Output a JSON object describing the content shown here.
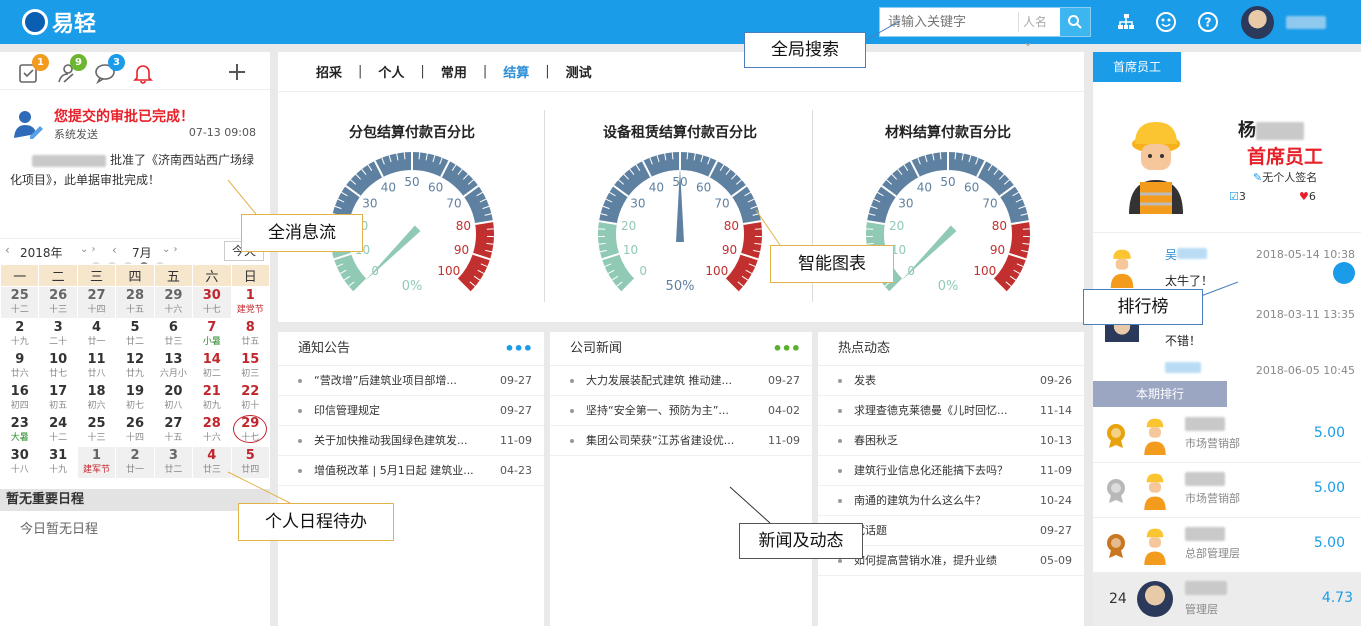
{
  "header": {
    "logo_text": "易轻",
    "search_placeholder": "请输入关键字",
    "search_scope": "人名",
    "icons": [
      "org-chart-icon",
      "smile-icon",
      "help-icon"
    ]
  },
  "left": {
    "badges": {
      "tasks": "1",
      "contacts": "9",
      "chat": "3"
    },
    "message": {
      "title": "您提交的审批已完成！",
      "from": "系统发送",
      "time": "07-13 09:08",
      "body": "批准了《济南西站西广场绿化项目》，此单据审批完成！"
    },
    "calendar": {
      "year": "2018年",
      "month": "7月",
      "today": "今天",
      "weekdays": [
        "一",
        "二",
        "三",
        "四",
        "五",
        "六",
        "日"
      ],
      "rows": [
        [
          [
            "25",
            "十二",
            "o"
          ],
          [
            "26",
            "十三",
            "o"
          ],
          [
            "27",
            "十四",
            "o"
          ],
          [
            "28",
            "十五",
            "o"
          ],
          [
            "29",
            "十六",
            "o"
          ],
          [
            "30",
            "十七",
            "ow"
          ],
          [
            "1",
            "建党节",
            "wr"
          ]
        ],
        [
          [
            "2",
            "十九",
            ""
          ],
          [
            "3",
            "二十",
            ""
          ],
          [
            "4",
            "廿一",
            ""
          ],
          [
            "5",
            "廿二",
            ""
          ],
          [
            "6",
            "廿三",
            ""
          ],
          [
            "7",
            "小暑",
            "wg"
          ],
          [
            "8",
            "廿五",
            "w"
          ]
        ],
        [
          [
            "9",
            "廿六",
            ""
          ],
          [
            "10",
            "廿七",
            ""
          ],
          [
            "11",
            "廿八",
            ""
          ],
          [
            "12",
            "廿九",
            ""
          ],
          [
            "13",
            "六月小",
            ""
          ],
          [
            "14",
            "初二",
            "w"
          ],
          [
            "15",
            "初三",
            "w"
          ]
        ],
        [
          [
            "16",
            "初四",
            ""
          ],
          [
            "17",
            "初五",
            ""
          ],
          [
            "18",
            "初六",
            ""
          ],
          [
            "19",
            "初七",
            ""
          ],
          [
            "20",
            "初八",
            ""
          ],
          [
            "21",
            "初九",
            "w"
          ],
          [
            "22",
            "初十",
            "w"
          ]
        ],
        [
          [
            "23",
            "大暑",
            "g"
          ],
          [
            "24",
            "十二",
            ""
          ],
          [
            "25",
            "十三",
            ""
          ],
          [
            "26",
            "十四",
            ""
          ],
          [
            "27",
            "十五",
            ""
          ],
          [
            "28",
            "十六",
            "w"
          ],
          [
            "29",
            "十七",
            "wt"
          ]
        ],
        [
          [
            "30",
            "十八",
            ""
          ],
          [
            "31",
            "十九",
            ""
          ],
          [
            "1",
            "建军节",
            "or"
          ],
          [
            "2",
            "廿一",
            "o"
          ],
          [
            "3",
            "廿二",
            "o"
          ],
          [
            "4",
            "廿三",
            "ow"
          ],
          [
            "5",
            "廿四",
            "ow"
          ]
        ]
      ]
    },
    "schedule_title": "暂无重要日程",
    "schedule_empty": "今日暂无日程"
  },
  "tabs": [
    "招采",
    "个人",
    "常用",
    "结算",
    "测试"
  ],
  "active_tab": "结算",
  "gauges": [
    {
      "title": "分包结算付款百分比",
      "value": 0,
      "label": "0%"
    },
    {
      "title": "设备租赁结算付款百分比",
      "value": 50,
      "label": "50%"
    },
    {
      "title": "材料结算付款百分比",
      "value": 0,
      "label": "0%"
    }
  ],
  "gauge_ticks": [
    "0",
    "10",
    "20",
    "30",
    "40",
    "50",
    "60",
    "70",
    "80",
    "90",
    "100"
  ],
  "panels": [
    {
      "title": "通知公告",
      "more_color": "#1a9ce9",
      "items": [
        {
          "t": "“营改增”后建筑业项目部增...",
          "d": "09-27"
        },
        {
          "t": "印信管理规定",
          "d": "09-27"
        },
        {
          "t": "关于加快推动我国绿色建筑发...",
          "d": "11-09"
        },
        {
          "t": "增值税改革 | 5月1日起 建筑业...",
          "d": "04-23"
        }
      ]
    },
    {
      "title": "公司新闻",
      "more_color": "#5ab02e",
      "items": [
        {
          "t": "大力发展装配式建筑   推动建...",
          "d": "09-27"
        },
        {
          "t": "坚持“安全第一、预防为主”...",
          "d": "04-02"
        },
        {
          "t": "集团公司荣获“江苏省建设优...",
          "d": "11-09"
        }
      ]
    },
    {
      "title": "热点动态",
      "more_color": "",
      "items": [
        {
          "t": "发表",
          "d": "09-26"
        },
        {
          "t": "求理查德克莱德曼《儿时回忆...",
          "d": "11-14"
        },
        {
          "t": "春困秋乏",
          "d": "10-13"
        },
        {
          "t": "建筑行业信息化还能搞下去吗？",
          "d": "11-09"
        },
        {
          "t": "南通的建筑为什么这么牛？",
          "d": "10-24"
        },
        {
          "t": "试话题",
          "d": "09-27"
        },
        {
          "t": "如何提高营销水准，提升业绩",
          "d": "05-09"
        }
      ]
    }
  ],
  "right": {
    "tab_top": "首席员工",
    "name": "杨",
    "star_title": "首席员工",
    "signature": "无个人签名",
    "edit_count": "3",
    "like_count": "6",
    "comments": [
      {
        "n": "吴",
        "dt": "2018-05-14 10:38",
        "tx": "太牛了！"
      },
      {
        "n": "",
        "dt": "2018-03-11 13:35",
        "tx": "不错！"
      },
      {
        "n": "",
        "dt": "2018-06-05 10:45",
        "tx": ""
      }
    ],
    "tab_rank": "本期排行",
    "ranks": [
      {
        "dept": "市场营销部",
        "sc": "5.00"
      },
      {
        "dept": "市场营销部",
        "sc": "5.00"
      },
      {
        "dept": "总部管理层",
        "sc": "5.00"
      }
    ],
    "me": {
      "rank": "24",
      "dept": "管理层",
      "sc": "4.73"
    }
  },
  "callouts": {
    "search": "全局搜索",
    "msg": "全消息流",
    "chart": "智能图表",
    "rank": "排行榜",
    "sched": "个人日程待办",
    "news": "新闻及动态"
  }
}
